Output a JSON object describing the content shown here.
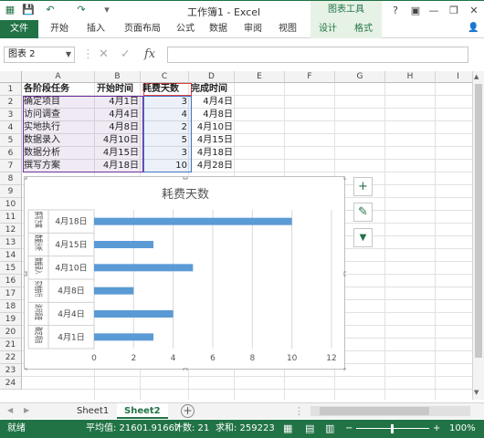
{
  "window": {
    "title": "工作簿1 - Excel",
    "chart_tools": "图表工具",
    "help": "?",
    "minimize": "—",
    "restore": "❐",
    "close": "✕"
  },
  "qat": {
    "save_icon": "💾",
    "undo_icon": "↶",
    "redo_icon": "↷"
  },
  "ribbon": {
    "tabs": [
      "文件",
      "开始",
      "插入",
      "页面布局",
      "公式",
      "数据",
      "审阅",
      "视图",
      "设计",
      "格式"
    ]
  },
  "formula_bar": {
    "name_box": "图表 2",
    "cancel": "✕",
    "enter": "✓",
    "fx": "fx",
    "value": ""
  },
  "columns": [
    "A",
    "B",
    "C",
    "D",
    "E",
    "F",
    "G",
    "H",
    "I"
  ],
  "rows": [
    "1",
    "2",
    "3",
    "4",
    "5",
    "6",
    "7",
    "8",
    "9",
    "10",
    "11",
    "12",
    "13",
    "14",
    "15",
    "16",
    "17",
    "18",
    "19",
    "20",
    "21",
    "22",
    "23",
    "24"
  ],
  "table": {
    "headers": [
      "各阶段任务",
      "开始时间",
      "耗费天数",
      "完成时间"
    ],
    "data": [
      [
        "确定项目",
        "4月1日",
        "3",
        "4月4日"
      ],
      [
        "访问调查",
        "4月4日",
        "4",
        "4月8日"
      ],
      [
        "实地执行",
        "4月8日",
        "2",
        "4月10日"
      ],
      [
        "数据录入",
        "4月10日",
        "5",
        "4月15日"
      ],
      [
        "数据分析",
        "4月15日",
        "3",
        "4月18日"
      ],
      [
        "撰写方案",
        "4月18日",
        "10",
        "4月28日"
      ]
    ]
  },
  "chart_data": {
    "type": "bar",
    "orientation": "horizontal",
    "title": "耗费天数",
    "categories": [
      {
        "task": "撰写方案",
        "date": "4月18日",
        "value": 10
      },
      {
        "task": "数据分析",
        "date": "4月15日",
        "value": 3
      },
      {
        "task": "数据录入",
        "date": "4月10日",
        "value": 5
      },
      {
        "task": "实地执行",
        "date": "4月8日",
        "value": 2
      },
      {
        "task": "访问调查",
        "date": "4月4日",
        "value": 4
      },
      {
        "task": "确定项目",
        "date": "4月1日",
        "value": 3
      }
    ],
    "xlim": [
      0,
      12
    ],
    "xticks": [
      "0",
      "2",
      "4",
      "6",
      "8",
      "10",
      "12"
    ],
    "grid": true,
    "bar_color": "#5b9bd5"
  },
  "chart_side_buttons": {
    "add": "+",
    "brush": "✎",
    "filter": "▼"
  },
  "sheets": {
    "tabs": [
      "Sheet1",
      "Sheet2"
    ],
    "active": "Sheet2",
    "add": "+",
    "prev": "◀",
    "next": "▶"
  },
  "status": {
    "mode": "就绪",
    "average": "平均值: 21601.91667",
    "count": "计数: 21",
    "sum": "求和: 259223",
    "zoom": "100%",
    "zoom_minus": "−",
    "zoom_plus": "+"
  },
  "colors": {
    "accent": "#217346",
    "chart_tools_bg": "#e6f2e6"
  }
}
